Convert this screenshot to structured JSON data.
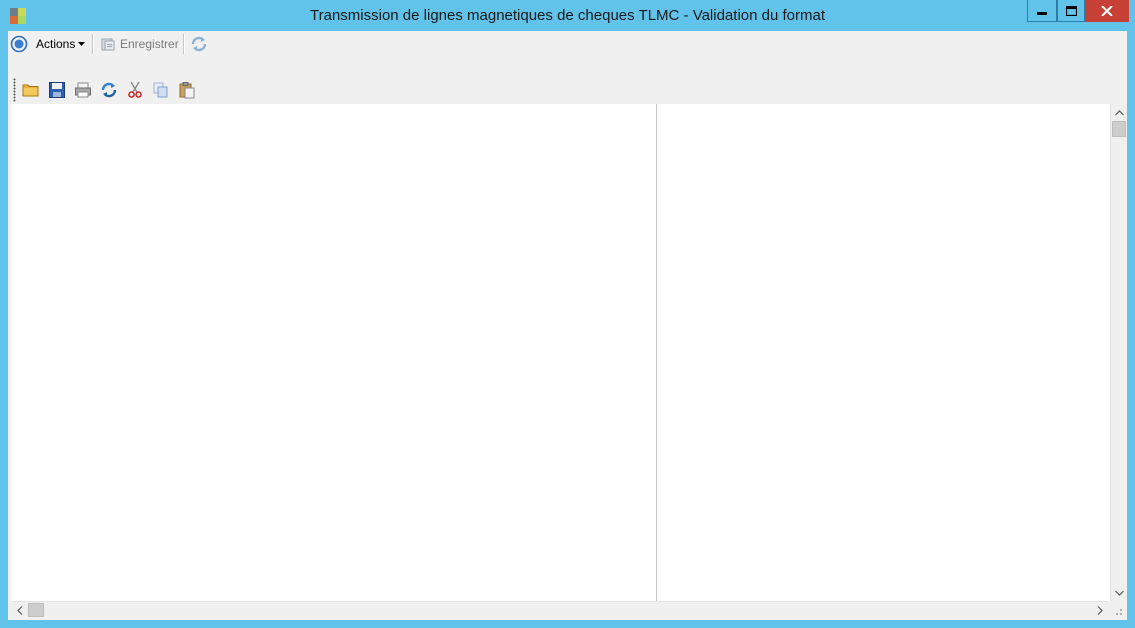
{
  "window": {
    "title": "Transmission de lignes magnetiques de cheques TLMC -  Validation du format",
    "controls": [
      "minimize-icon",
      "maximize-icon",
      "close-icon"
    ]
  },
  "menubar": {
    "actions_label": "Actions",
    "save_label": "Enregistrer"
  },
  "toolbar": {
    "icons": [
      "folder-open-icon",
      "save-icon",
      "print-icon",
      "refresh-icon",
      "cut-icon",
      "copy-icon",
      "paste-icon"
    ]
  },
  "colors": {
    "titlebar": "#61c2ea",
    "close_button": "#c74036",
    "client_bg": "#f0f0f0"
  }
}
